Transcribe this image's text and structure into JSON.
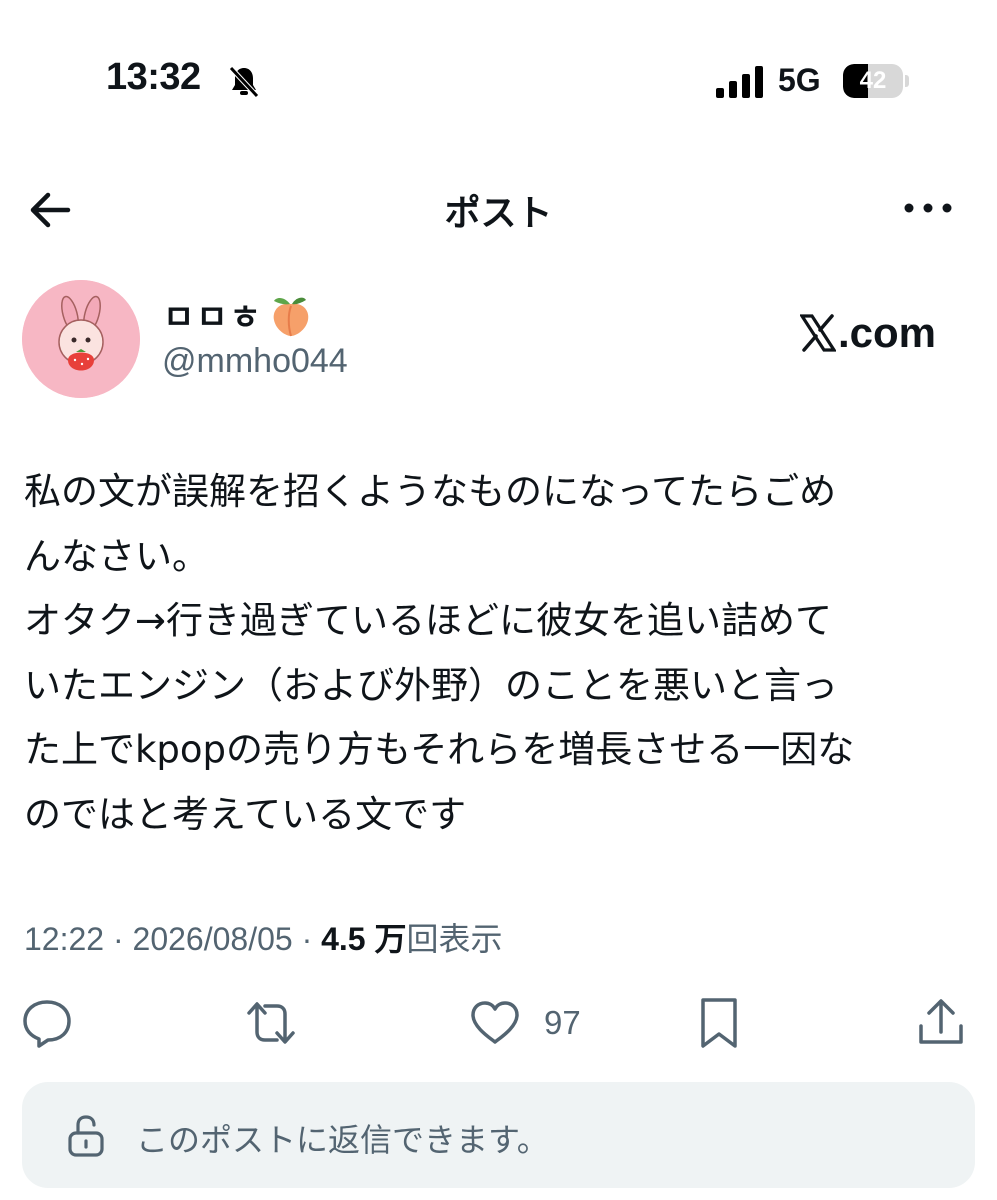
{
  "status_bar": {
    "time": "13:32",
    "network": "5G",
    "battery_level": "42",
    "battery_fraction": 0.42,
    "icons": [
      "bell-slash-icon",
      "signal-icon"
    ]
  },
  "header": {
    "title": "ポスト",
    "icons": [
      "back-arrow-icon",
      "more-icon"
    ]
  },
  "post": {
    "author": {
      "display_name": "ㅁㅁㅎ",
      "emoji_icon": "peach-icon",
      "handle": "@mmho044"
    },
    "source_badge": "X.com",
    "body_lines": [
      "私の文が誤解を招くようなものになってたらごめ",
      "んなさい。",
      "オタク→行き過ぎているほどに彼女を追い詰めて",
      "いたエンジン（および外野）のことを悪いと言っ",
      "た上でkpopの売り方もそれらを増長させる一因な",
      "のではと考えている文です"
    ],
    "time": "12:22",
    "separator": "·",
    "date": "2026/08/05",
    "views_count": "4.5 万",
    "views_label": "回表示"
  },
  "actions": {
    "like_count": "97",
    "icons": [
      "reply-icon",
      "repost-icon",
      "like-icon",
      "bookmark-icon",
      "share-icon"
    ]
  },
  "reply": {
    "placeholder": "このポストに返信できます。",
    "icon": "unlock-icon"
  },
  "colors": {
    "text": "#0f1419",
    "secondary": "#536471",
    "reply_bg": "#eff3f4",
    "avatar_bg": "#f7b7c4"
  }
}
